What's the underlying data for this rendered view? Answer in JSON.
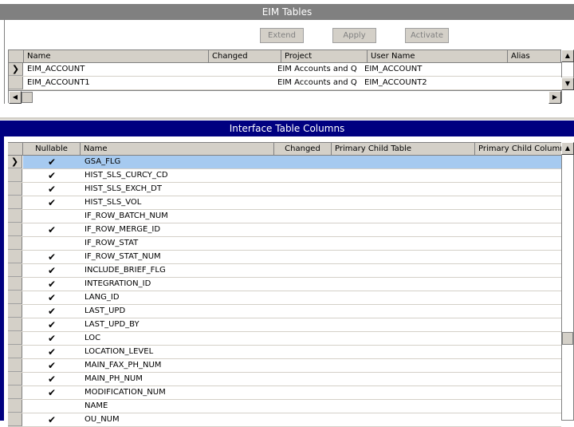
{
  "eim_tables": {
    "title": "EIM Tables",
    "buttons": {
      "extend": "Extend",
      "apply": "Apply",
      "activate": "Activate"
    },
    "columns": [
      "Name",
      "Changed",
      "Project",
      "User Name",
      "Alias"
    ],
    "rows": [
      {
        "name": "EIM_ACCOUNT",
        "changed": "",
        "project": "EIM Accounts and Qu",
        "user_name": "EIM_ACCOUNT",
        "alias": ""
      },
      {
        "name": "EIM_ACCOUNT1",
        "changed": "",
        "project": "EIM Accounts and Qu",
        "user_name": "EIM_ACCOUNT2",
        "alias": ""
      }
    ]
  },
  "interface_columns": {
    "title": "Interface Table Columns",
    "columns": [
      "Nullable",
      "Name",
      "Changed",
      "Primary Child Table",
      "Primary Child Column"
    ],
    "rows": [
      {
        "nullable": true,
        "name": "GSA_FLG",
        "selected": true
      },
      {
        "nullable": true,
        "name": "HIST_SLS_CURCY_CD"
      },
      {
        "nullable": true,
        "name": "HIST_SLS_EXCH_DT"
      },
      {
        "nullable": true,
        "name": "HIST_SLS_VOL"
      },
      {
        "nullable": false,
        "name": "IF_ROW_BATCH_NUM"
      },
      {
        "nullable": true,
        "name": "IF_ROW_MERGE_ID"
      },
      {
        "nullable": false,
        "name": "IF_ROW_STAT"
      },
      {
        "nullable": true,
        "name": "IF_ROW_STAT_NUM"
      },
      {
        "nullable": true,
        "name": "INCLUDE_BRIEF_FLG"
      },
      {
        "nullable": true,
        "name": "INTEGRATION_ID"
      },
      {
        "nullable": true,
        "name": "LANG_ID"
      },
      {
        "nullable": true,
        "name": "LAST_UPD"
      },
      {
        "nullable": true,
        "name": "LAST_UPD_BY"
      },
      {
        "nullable": true,
        "name": "LOC"
      },
      {
        "nullable": true,
        "name": "LOCATION_LEVEL"
      },
      {
        "nullable": true,
        "name": "MAIN_FAX_PH_NUM"
      },
      {
        "nullable": true,
        "name": "MAIN_PH_NUM"
      },
      {
        "nullable": true,
        "name": "MODIFICATION_NUM"
      },
      {
        "nullable": false,
        "name": "NAME"
      },
      {
        "nullable": true,
        "name": "OU_NUM"
      }
    ]
  },
  "icons": {
    "check": "checkmark-icon",
    "row_pointer": "row-pointer-icon",
    "scroll_up": "scroll-up-icon",
    "scroll_down": "scroll-down-icon",
    "scroll_left": "scroll-left-icon",
    "scroll_right": "scroll-right-icon"
  },
  "colors": {
    "active_title": "#000080",
    "inactive_title": "#808080",
    "selected_row": "#a6caf0",
    "chrome": "#d4d0c8"
  }
}
